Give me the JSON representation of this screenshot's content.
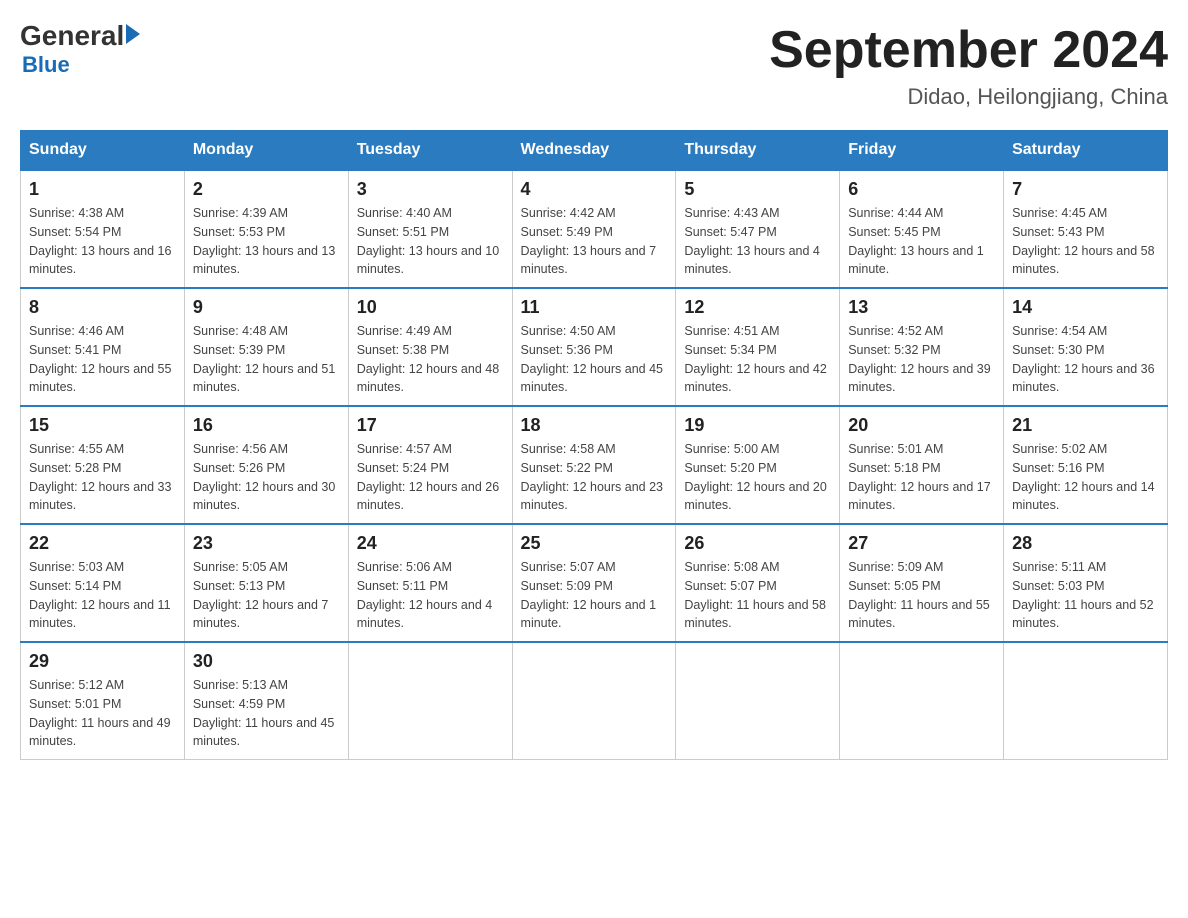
{
  "header": {
    "logo_general": "General",
    "logo_blue": "Blue",
    "month_title": "September 2024",
    "location": "Didao, Heilongjiang, China"
  },
  "weekdays": [
    "Sunday",
    "Monday",
    "Tuesday",
    "Wednesday",
    "Thursday",
    "Friday",
    "Saturday"
  ],
  "weeks": [
    [
      {
        "day": "1",
        "sunrise": "4:38 AM",
        "sunset": "5:54 PM",
        "daylight": "13 hours and 16 minutes."
      },
      {
        "day": "2",
        "sunrise": "4:39 AM",
        "sunset": "5:53 PM",
        "daylight": "13 hours and 13 minutes."
      },
      {
        "day": "3",
        "sunrise": "4:40 AM",
        "sunset": "5:51 PM",
        "daylight": "13 hours and 10 minutes."
      },
      {
        "day": "4",
        "sunrise": "4:42 AM",
        "sunset": "5:49 PM",
        "daylight": "13 hours and 7 minutes."
      },
      {
        "day": "5",
        "sunrise": "4:43 AM",
        "sunset": "5:47 PM",
        "daylight": "13 hours and 4 minutes."
      },
      {
        "day": "6",
        "sunrise": "4:44 AM",
        "sunset": "5:45 PM",
        "daylight": "13 hours and 1 minute."
      },
      {
        "day": "7",
        "sunrise": "4:45 AM",
        "sunset": "5:43 PM",
        "daylight": "12 hours and 58 minutes."
      }
    ],
    [
      {
        "day": "8",
        "sunrise": "4:46 AM",
        "sunset": "5:41 PM",
        "daylight": "12 hours and 55 minutes."
      },
      {
        "day": "9",
        "sunrise": "4:48 AM",
        "sunset": "5:39 PM",
        "daylight": "12 hours and 51 minutes."
      },
      {
        "day": "10",
        "sunrise": "4:49 AM",
        "sunset": "5:38 PM",
        "daylight": "12 hours and 48 minutes."
      },
      {
        "day": "11",
        "sunrise": "4:50 AM",
        "sunset": "5:36 PM",
        "daylight": "12 hours and 45 minutes."
      },
      {
        "day": "12",
        "sunrise": "4:51 AM",
        "sunset": "5:34 PM",
        "daylight": "12 hours and 42 minutes."
      },
      {
        "day": "13",
        "sunrise": "4:52 AM",
        "sunset": "5:32 PM",
        "daylight": "12 hours and 39 minutes."
      },
      {
        "day": "14",
        "sunrise": "4:54 AM",
        "sunset": "5:30 PM",
        "daylight": "12 hours and 36 minutes."
      }
    ],
    [
      {
        "day": "15",
        "sunrise": "4:55 AM",
        "sunset": "5:28 PM",
        "daylight": "12 hours and 33 minutes."
      },
      {
        "day": "16",
        "sunrise": "4:56 AM",
        "sunset": "5:26 PM",
        "daylight": "12 hours and 30 minutes."
      },
      {
        "day": "17",
        "sunrise": "4:57 AM",
        "sunset": "5:24 PM",
        "daylight": "12 hours and 26 minutes."
      },
      {
        "day": "18",
        "sunrise": "4:58 AM",
        "sunset": "5:22 PM",
        "daylight": "12 hours and 23 minutes."
      },
      {
        "day": "19",
        "sunrise": "5:00 AM",
        "sunset": "5:20 PM",
        "daylight": "12 hours and 20 minutes."
      },
      {
        "day": "20",
        "sunrise": "5:01 AM",
        "sunset": "5:18 PM",
        "daylight": "12 hours and 17 minutes."
      },
      {
        "day": "21",
        "sunrise": "5:02 AM",
        "sunset": "5:16 PM",
        "daylight": "12 hours and 14 minutes."
      }
    ],
    [
      {
        "day": "22",
        "sunrise": "5:03 AM",
        "sunset": "5:14 PM",
        "daylight": "12 hours and 11 minutes."
      },
      {
        "day": "23",
        "sunrise": "5:05 AM",
        "sunset": "5:13 PM",
        "daylight": "12 hours and 7 minutes."
      },
      {
        "day": "24",
        "sunrise": "5:06 AM",
        "sunset": "5:11 PM",
        "daylight": "12 hours and 4 minutes."
      },
      {
        "day": "25",
        "sunrise": "5:07 AM",
        "sunset": "5:09 PM",
        "daylight": "12 hours and 1 minute."
      },
      {
        "day": "26",
        "sunrise": "5:08 AM",
        "sunset": "5:07 PM",
        "daylight": "11 hours and 58 minutes."
      },
      {
        "day": "27",
        "sunrise": "5:09 AM",
        "sunset": "5:05 PM",
        "daylight": "11 hours and 55 minutes."
      },
      {
        "day": "28",
        "sunrise": "5:11 AM",
        "sunset": "5:03 PM",
        "daylight": "11 hours and 52 minutes."
      }
    ],
    [
      {
        "day": "29",
        "sunrise": "5:12 AM",
        "sunset": "5:01 PM",
        "daylight": "11 hours and 49 minutes."
      },
      {
        "day": "30",
        "sunrise": "5:13 AM",
        "sunset": "4:59 PM",
        "daylight": "11 hours and 45 minutes."
      },
      null,
      null,
      null,
      null,
      null
    ]
  ]
}
